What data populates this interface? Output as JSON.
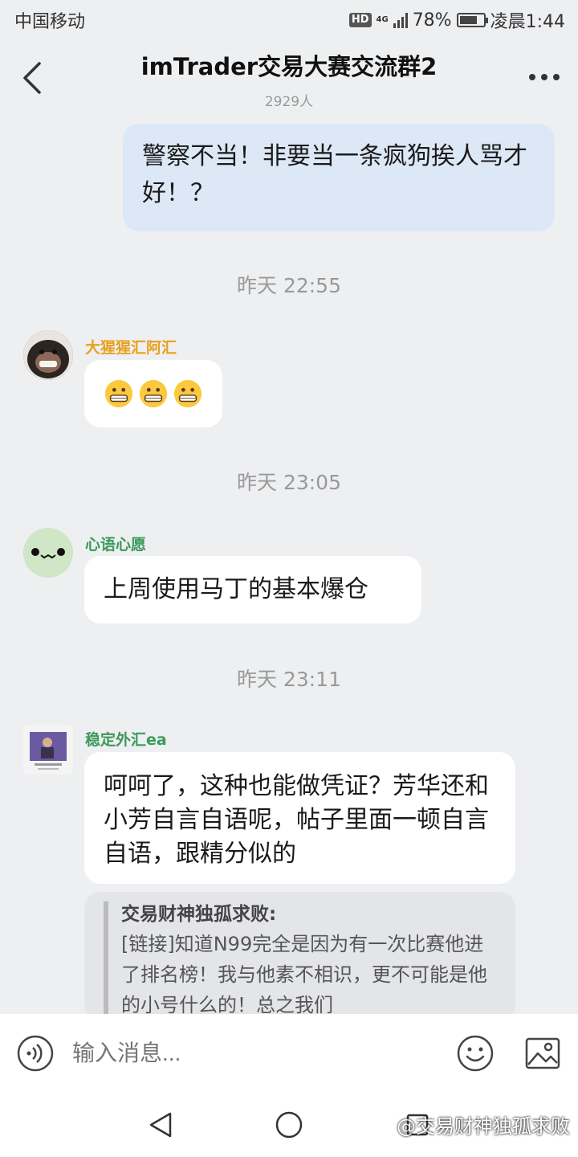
{
  "status_bar": {
    "carrier": "中国移动",
    "hd": "HD",
    "network": "4G",
    "battery": "78%",
    "battery_level": 0.78,
    "time": "凌晨1:44"
  },
  "header": {
    "title": "imTrader交易大赛交流群2",
    "member_count": "2929人"
  },
  "messages": {
    "self_message": "警察不当！非要当一条疯狗挨人骂才好！？",
    "time_1": "昨天 22:55",
    "sender_1": {
      "name": "大猩猩汇阿汇",
      "color": "#e8a020"
    },
    "time_2": "昨天 23:05",
    "sender_2": {
      "name": "心语心愿",
      "color": "#3a9a5a",
      "text": "上周使用马丁的基本爆仓"
    },
    "time_3": "昨天 23:11",
    "sender_3": {
      "name": "稳定外汇ea",
      "color": "#3a9a5a",
      "text": "呵呵了，这种也能做凭证？芳华还和小芳自言自语呢，帖子里面一顿自言自语，跟精分似的"
    },
    "quote": {
      "author": "交易财神独孤求败:",
      "text": "[链接]知道N99完全是因为有一次比赛他进了排名榜！我与他素不相识，更不可能是他的小号什么的！总之我们"
    }
  },
  "input_bar": {
    "placeholder": "输入消息..."
  },
  "nav_bar": {
    "watermark": "@交易财神独孤求败"
  }
}
